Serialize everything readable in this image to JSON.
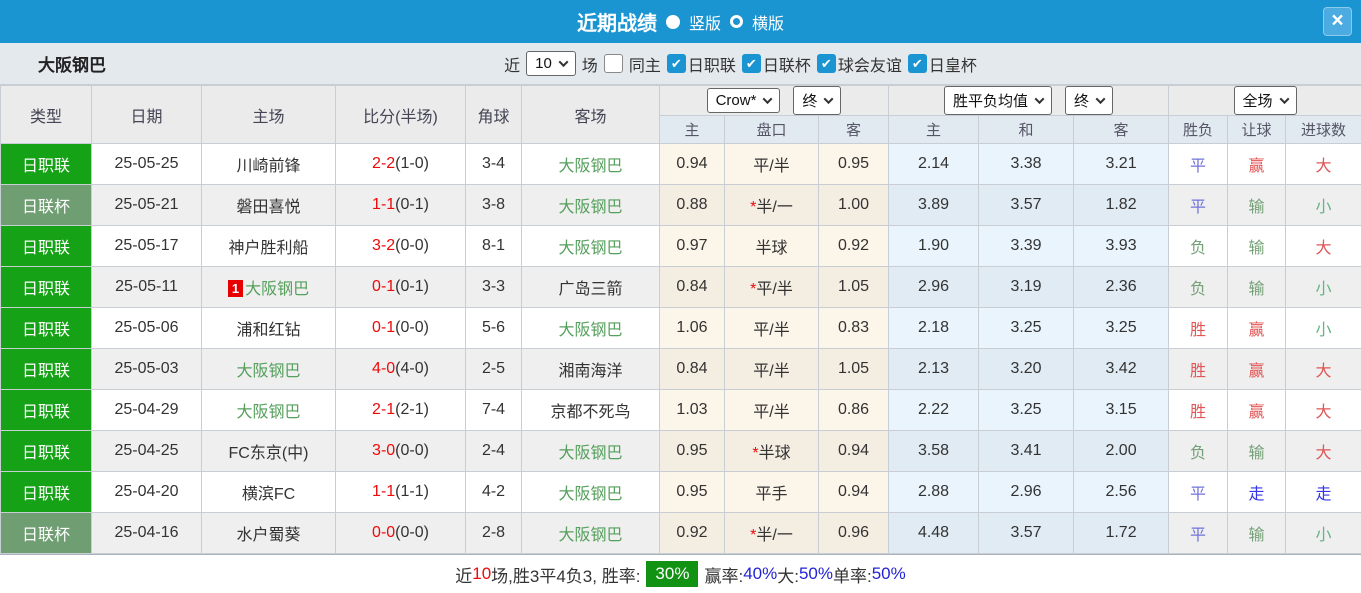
{
  "colors": {
    "titlebar_blue": "#1b94d2",
    "league_green": "#16a216",
    "cup_green": "#6f9e72",
    "self_team_green": "#55a05c",
    "score_red": "#ee0a0a",
    "result_red": "#e25555",
    "result_green": "#74a077",
    "result_lightgreen": "#64b584",
    "result_purple": "#7173d8",
    "result_blue": "#3636ec",
    "summary_badge_green": "#129212"
  },
  "titlebar": {
    "title": "近期战绩",
    "vertical_label": "竖版",
    "horizontal_label": "横版",
    "close": "×"
  },
  "filterbar": {
    "team": "大阪钢巴",
    "near_label": "近",
    "games_value": "10",
    "games_suffix": "场",
    "same_home_label": "同主",
    "league_filters": [
      "日职联",
      "日联杯",
      "球会友谊",
      "日皇杯"
    ]
  },
  "table": {
    "main_headers": [
      "类型",
      "日期",
      "主场",
      "比分(半场)",
      "角球",
      "客场"
    ],
    "odds_select": "Crow*",
    "odds_period_select": "终",
    "odds_cols": [
      "主",
      "盘口",
      "客"
    ],
    "avg_select": "胜平负均值",
    "avg_period_select": "终",
    "avg_cols": [
      "主",
      "和",
      "客"
    ],
    "result_select": "全场",
    "result_cols": [
      "胜负",
      "让球",
      "进球数"
    ],
    "rows": [
      {
        "league": "日职联",
        "league_class": "league",
        "date": "25-05-25",
        "home": "川崎前锋",
        "home_self": false,
        "home_badge": "",
        "ft": "2-2",
        "ht": "(1-0)",
        "corner": "3-4",
        "away": "大阪钢巴",
        "away_self": true,
        "o1": "0.94",
        "star": false,
        "handicap": "平/半",
        "o2": "0.95",
        "a1": "2.14",
        "a2": "3.38",
        "a3": "3.21",
        "r1": {
          "t": "平",
          "c": "purple"
        },
        "r2": {
          "t": "赢",
          "c": "red"
        },
        "r3": {
          "t": "大",
          "c": "red"
        }
      },
      {
        "league": "日联杯",
        "league_class": "cup",
        "date": "25-05-21",
        "home": "磐田喜悦",
        "home_self": false,
        "home_badge": "",
        "ft": "1-1",
        "ht": "(0-1)",
        "corner": "3-8",
        "away": "大阪钢巴",
        "away_self": true,
        "o1": "0.88",
        "star": true,
        "handicap": "半/一",
        "o2": "1.00",
        "a1": "3.89",
        "a2": "3.57",
        "a3": "1.82",
        "r1": {
          "t": "平",
          "c": "purple"
        },
        "r2": {
          "t": "输",
          "c": "green"
        },
        "r3": {
          "t": "小",
          "c": "lightgreen"
        }
      },
      {
        "league": "日职联",
        "league_class": "league",
        "date": "25-05-17",
        "home": "神户胜利船",
        "home_self": false,
        "home_badge": "",
        "ft": "3-2",
        "ht": "(0-0)",
        "corner": "8-1",
        "away": "大阪钢巴",
        "away_self": true,
        "o1": "0.97",
        "star": false,
        "handicap": "半球",
        "o2": "0.92",
        "a1": "1.90",
        "a2": "3.39",
        "a3": "3.93",
        "r1": {
          "t": "负",
          "c": "green"
        },
        "r2": {
          "t": "输",
          "c": "green"
        },
        "r3": {
          "t": "大",
          "c": "red"
        }
      },
      {
        "league": "日职联",
        "league_class": "league",
        "date": "25-05-11",
        "home": "大阪钢巴",
        "home_self": true,
        "home_badge": "1",
        "ft": "0-1",
        "ht": "(0-1)",
        "corner": "3-3",
        "away": "广岛三箭",
        "away_self": false,
        "o1": "0.84",
        "star": true,
        "handicap": "平/半",
        "o2": "1.05",
        "a1": "2.96",
        "a2": "3.19",
        "a3": "2.36",
        "r1": {
          "t": "负",
          "c": "green"
        },
        "r2": {
          "t": "输",
          "c": "green"
        },
        "r3": {
          "t": "小",
          "c": "lightgreen"
        }
      },
      {
        "league": "日职联",
        "league_class": "league",
        "date": "25-05-06",
        "home": "浦和红钻",
        "home_self": false,
        "home_badge": "",
        "ft": "0-1",
        "ht": "(0-0)",
        "corner": "5-6",
        "away": "大阪钢巴",
        "away_self": true,
        "o1": "1.06",
        "star": false,
        "handicap": "平/半",
        "o2": "0.83",
        "a1": "2.18",
        "a2": "3.25",
        "a3": "3.25",
        "r1": {
          "t": "胜",
          "c": "red"
        },
        "r2": {
          "t": "赢",
          "c": "red"
        },
        "r3": {
          "t": "小",
          "c": "lightgreen"
        }
      },
      {
        "league": "日职联",
        "league_class": "league",
        "date": "25-05-03",
        "home": "大阪钢巴",
        "home_self": true,
        "home_badge": "",
        "ft": "4-0",
        "ht": "(4-0)",
        "corner": "2-5",
        "away": "湘南海洋",
        "away_self": false,
        "o1": "0.84",
        "star": false,
        "handicap": "平/半",
        "o2": "1.05",
        "a1": "2.13",
        "a2": "3.20",
        "a3": "3.42",
        "r1": {
          "t": "胜",
          "c": "red"
        },
        "r2": {
          "t": "赢",
          "c": "red"
        },
        "r3": {
          "t": "大",
          "c": "red"
        }
      },
      {
        "league": "日职联",
        "league_class": "league",
        "date": "25-04-29",
        "home": "大阪钢巴",
        "home_self": true,
        "home_badge": "",
        "ft": "2-1",
        "ht": "(2-1)",
        "corner": "7-4",
        "away": "京都不死鸟",
        "away_self": false,
        "o1": "1.03",
        "star": false,
        "handicap": "平/半",
        "o2": "0.86",
        "a1": "2.22",
        "a2": "3.25",
        "a3": "3.15",
        "r1": {
          "t": "胜",
          "c": "red"
        },
        "r2": {
          "t": "赢",
          "c": "red"
        },
        "r3": {
          "t": "大",
          "c": "red"
        }
      },
      {
        "league": "日职联",
        "league_class": "league",
        "date": "25-04-25",
        "home": "FC东京(中)",
        "home_self": false,
        "home_badge": "",
        "ft": "3-0",
        "ht": "(0-0)",
        "corner": "2-4",
        "away": "大阪钢巴",
        "away_self": true,
        "o1": "0.95",
        "star": true,
        "handicap": "半球",
        "o2": "0.94",
        "a1": "3.58",
        "a2": "3.41",
        "a3": "2.00",
        "r1": {
          "t": "负",
          "c": "green"
        },
        "r2": {
          "t": "输",
          "c": "green"
        },
        "r3": {
          "t": "大",
          "c": "red"
        }
      },
      {
        "league": "日职联",
        "league_class": "league",
        "date": "25-04-20",
        "home": "横滨FC",
        "home_self": false,
        "home_badge": "",
        "ft": "1-1",
        "ht": "(1-1)",
        "corner": "4-2",
        "away": "大阪钢巴",
        "away_self": true,
        "o1": "0.95",
        "star": false,
        "handicap": "平手",
        "o2": "0.94",
        "a1": "2.88",
        "a2": "2.96",
        "a3": "2.56",
        "r1": {
          "t": "平",
          "c": "purple"
        },
        "r2": {
          "t": "走",
          "c": "blue"
        },
        "r3": {
          "t": "走",
          "c": "blue"
        }
      },
      {
        "league": "日联杯",
        "league_class": "cup",
        "date": "25-04-16",
        "home": "水户蜀葵",
        "home_self": false,
        "home_badge": "",
        "ft": "0-0",
        "ht": "(0-0)",
        "corner": "2-8",
        "away": "大阪钢巴",
        "away_self": true,
        "o1": "0.92",
        "star": true,
        "handicap": "半/一",
        "o2": "0.96",
        "a1": "4.48",
        "a2": "3.57",
        "a3": "1.72",
        "r1": {
          "t": "平",
          "c": "purple"
        },
        "r2": {
          "t": "输",
          "c": "green"
        },
        "r3": {
          "t": "小",
          "c": "lightgreen"
        }
      }
    ]
  },
  "footer": {
    "segments": [
      {
        "text": "近",
        "style": "plain"
      },
      {
        "text": "10",
        "style": "red"
      },
      {
        "text": "场,胜3平4负3, 胜率:",
        "style": "plain"
      },
      {
        "text": "30%",
        "style": "badge"
      },
      {
        "text": "赢率:",
        "style": "plain"
      },
      {
        "text": "40%",
        "style": "blue"
      },
      {
        "text": " 大:",
        "style": "plain"
      },
      {
        "text": "50%",
        "style": "blue"
      },
      {
        "text": " 单率:",
        "style": "plain"
      },
      {
        "text": "50%",
        "style": "blue"
      }
    ]
  }
}
